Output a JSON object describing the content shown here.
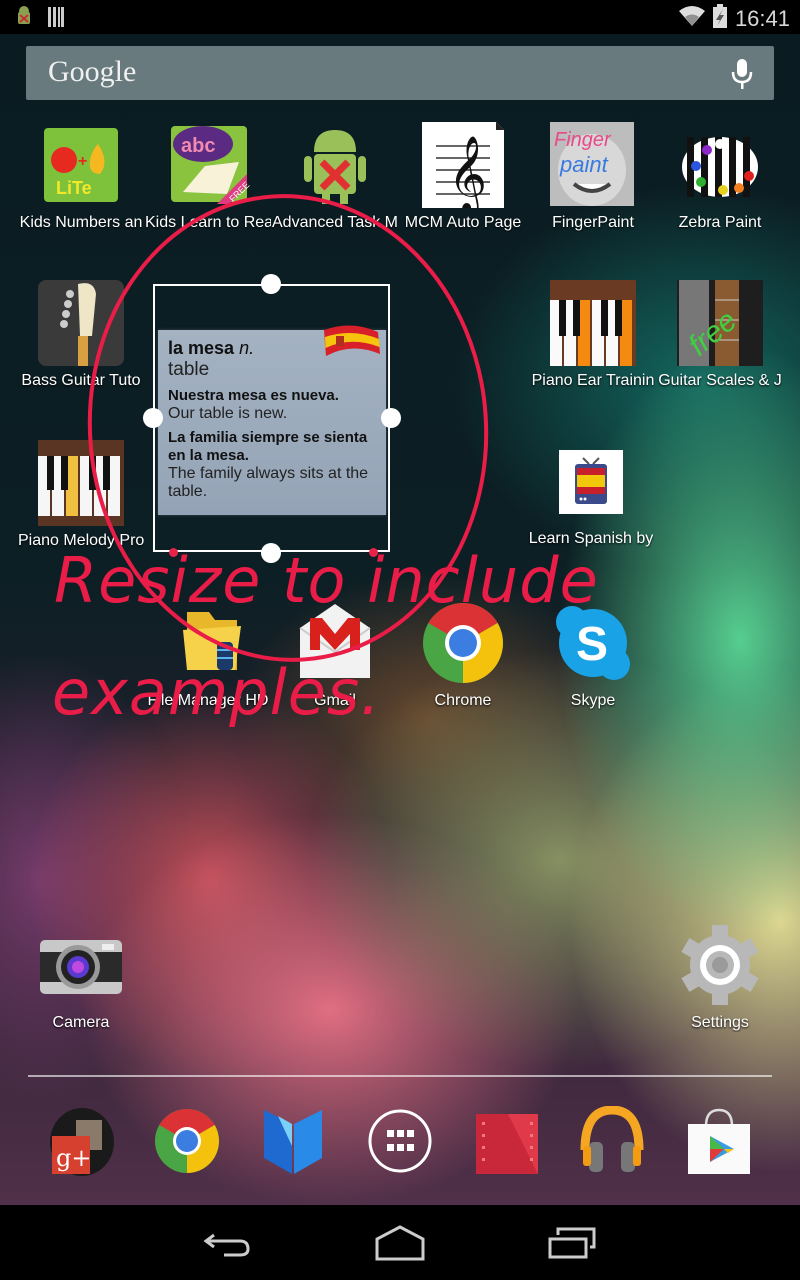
{
  "status_bar": {
    "left_icons": [
      "android-debug-icon",
      "barcode-icon"
    ],
    "right_icons": [
      "wifi-icon",
      "battery-icon"
    ],
    "time": "16:41"
  },
  "search": {
    "label": "Google",
    "mic_icon": "mic-icon"
  },
  "apps": [
    {
      "label": "Kids Numbers an",
      "icon": "kids-numbers-icon"
    },
    {
      "label": "Kids Learn to Rea",
      "icon": "kids-learn-read-icon"
    },
    {
      "label": "Advanced Task M",
      "icon": "task-manager-icon"
    },
    {
      "label": "MCM Auto Page",
      "icon": "treble-clef-icon"
    },
    {
      "label": "FingerPaint",
      "icon": "finger-paint-icon"
    },
    {
      "label": "Zebra Paint",
      "icon": "zebra-paint-icon"
    },
    {
      "label": "Bass Guitar Tuto",
      "icon": "bass-guitar-icon"
    },
    {
      "label": "Piano Ear Trainin",
      "icon": "piano-ear-icon"
    },
    {
      "label": "Guitar Scales & J",
      "icon": "guitar-scales-icon"
    },
    {
      "label": "Piano Melody Pro",
      "icon": "piano-melody-icon"
    },
    {
      "label": "Learn Spanish by",
      "icon": "learn-spanish-icon"
    },
    {
      "label": "File Manager HD",
      "icon": "file-manager-icon"
    },
    {
      "label": "Gmail",
      "icon": "gmail-icon"
    },
    {
      "label": "Chrome",
      "icon": "chrome-icon"
    },
    {
      "label": "Skype",
      "icon": "skype-icon"
    },
    {
      "label": "Camera",
      "icon": "camera-icon"
    },
    {
      "label": "Settings",
      "icon": "settings-icon"
    }
  ],
  "widget": {
    "word": "la mesa",
    "part_of_speech": "n.",
    "translation": "table",
    "examples": [
      {
        "es": "Nuestra mesa es nueva.",
        "en": "Our table is new."
      },
      {
        "es": "La familia siempre se sienta en la mesa.",
        "en": "The family always sits at the table."
      }
    ],
    "flag_icon": "spain-flag-icon"
  },
  "annotation": {
    "line1": "Resize to include",
    "line2": "examples.",
    "color": "#ea1d48"
  },
  "dock": [
    {
      "name": "google-plus",
      "icon": "google-plus-icon"
    },
    {
      "name": "chrome",
      "icon": "chrome-icon"
    },
    {
      "name": "play-books",
      "icon": "play-books-icon"
    },
    {
      "name": "app-drawer",
      "icon": "app-drawer-icon"
    },
    {
      "name": "play-movies",
      "icon": "play-movies-icon"
    },
    {
      "name": "play-music",
      "icon": "play-music-icon"
    },
    {
      "name": "play-store",
      "icon": "play-store-icon"
    }
  ],
  "nav": {
    "back": "back-icon",
    "home": "home-icon",
    "recents": "recents-icon"
  }
}
